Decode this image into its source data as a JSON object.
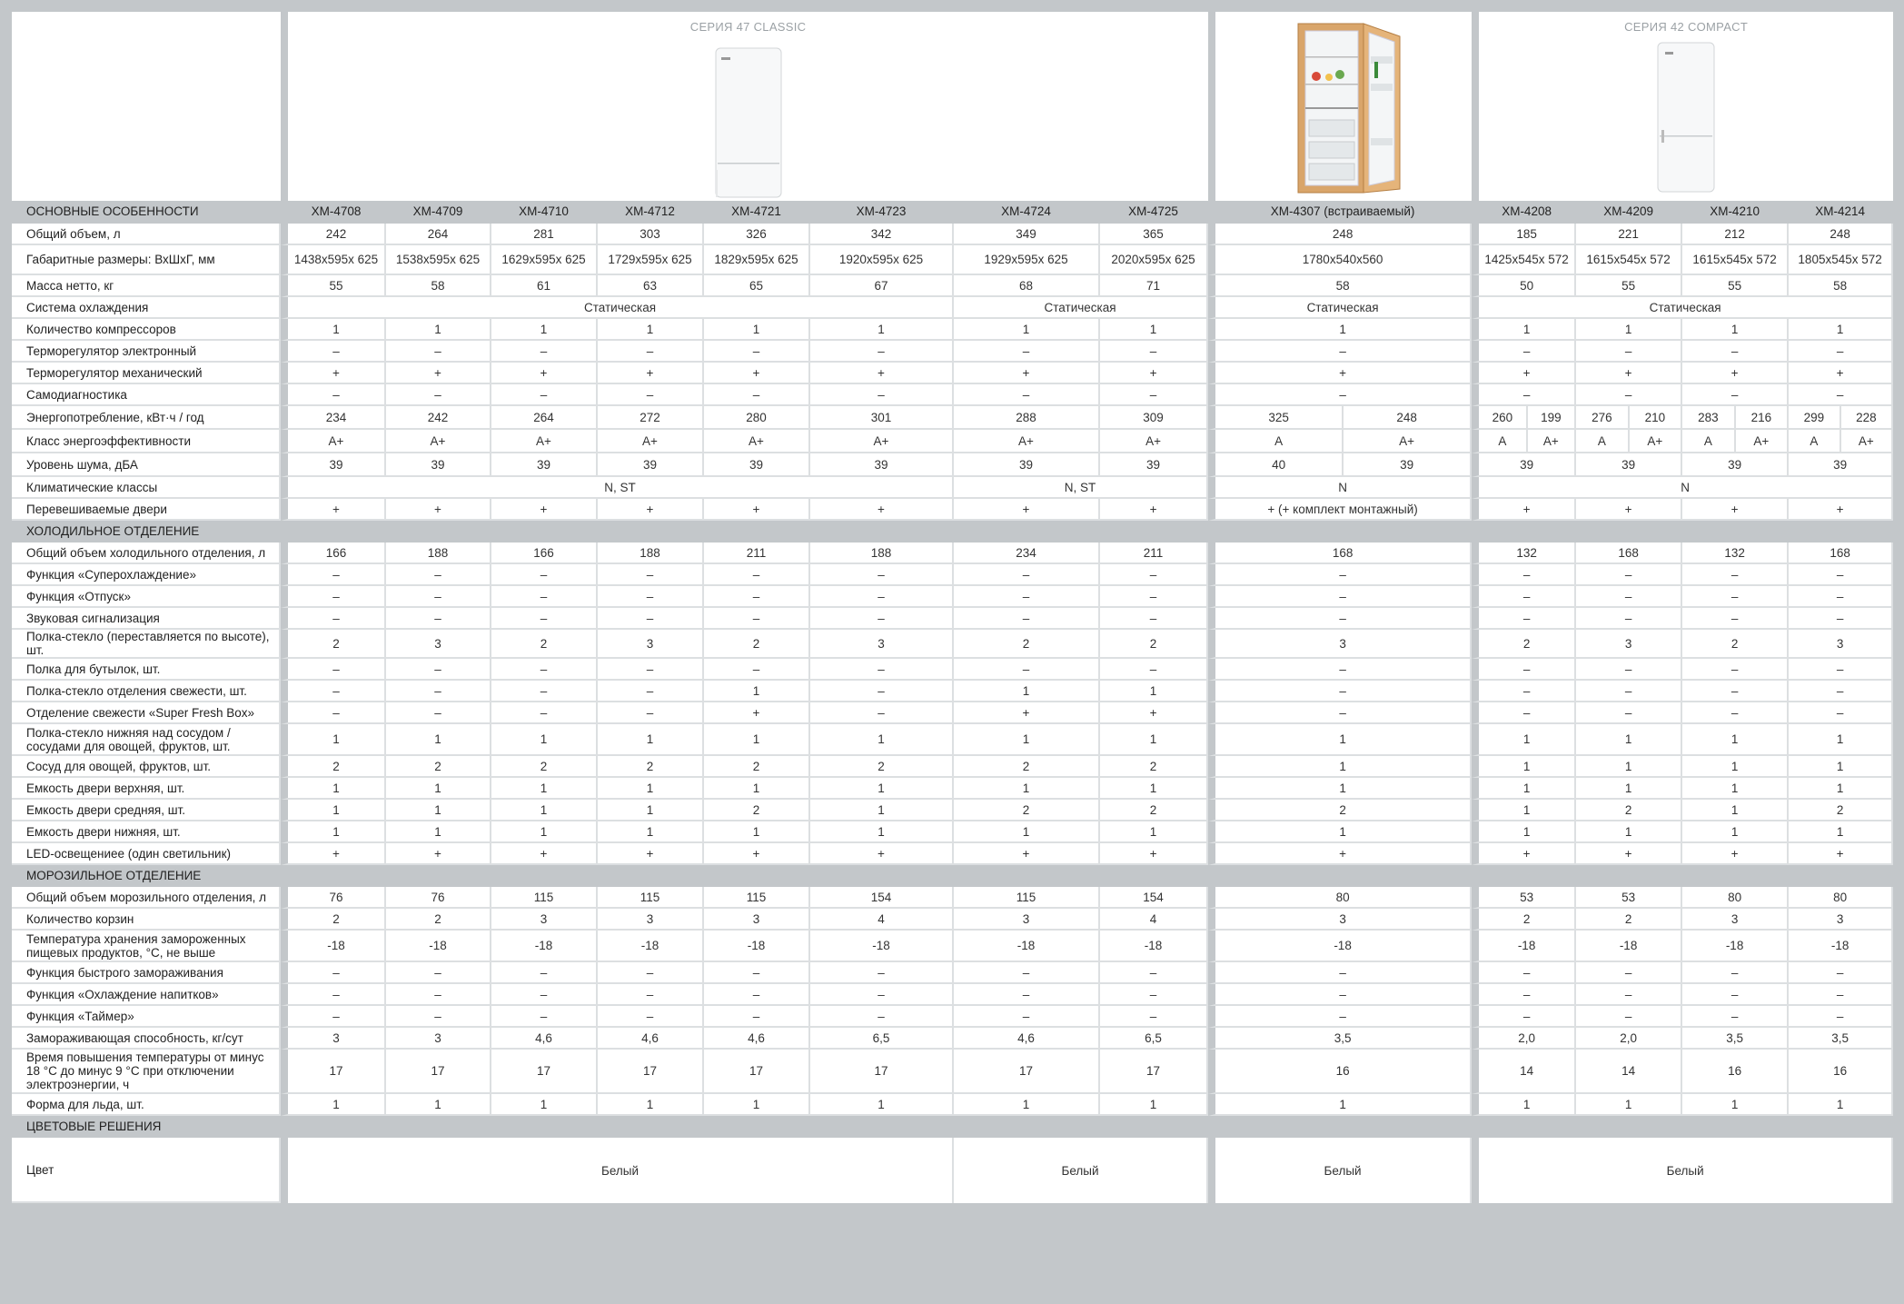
{
  "series": [
    {
      "name": "СЕРИЯ 47 CLASSIC"
    },
    {
      "name": ""
    },
    {
      "name": "СЕРИЯ 42 COMPACT"
    }
  ],
  "models_header": "ОСНОВНЫЕ ОСОБЕННОСТИ",
  "models": [
    "ХМ-4708",
    "ХМ-4709",
    "ХМ-4710",
    "ХМ-4712",
    "ХМ-4721",
    "ХМ-4723",
    "ХМ-4724",
    "ХМ-4725",
    "ХМ-4307 (встраиваемый)",
    "ХМ-4208",
    "ХМ-4209",
    "ХМ-4210",
    "ХМ-4214"
  ],
  "rows_main": [
    {
      "label": "Общий объем, л",
      "cells": [
        "242",
        "264",
        "281",
        "303",
        "326",
        "342",
        "349",
        "365",
        "248",
        "185",
        "221",
        "212",
        "248"
      ]
    },
    {
      "label": "Габаритные размеры: ВхШхГ, мм",
      "cells": [
        "1438x595x 625",
        "1538x595x 625",
        "1629x595x 625",
        "1729x595x 625",
        "1829x595x 625",
        "1920x595x 625",
        "1929x595x 625",
        "2020x595x 625",
        "1780x540x560",
        "1425x545x 572",
        "1615x545x 572",
        "1615x545x 572",
        "1805x545x 572"
      ]
    },
    {
      "label": "Масса нетто, кг",
      "cells": [
        "55",
        "58",
        "61",
        "63",
        "65",
        "67",
        "68",
        "71",
        "58",
        "50",
        "55",
        "55",
        "58"
      ]
    },
    {
      "label": "Система охлаждения",
      "merged": [
        "Статическая",
        "Статическая",
        "Статическая",
        "Статическая"
      ]
    },
    {
      "label": "Количество компрессоров",
      "cells": [
        "1",
        "1",
        "1",
        "1",
        "1",
        "1",
        "1",
        "1",
        "1",
        "1",
        "1",
        "1",
        "1"
      ]
    },
    {
      "label": "Терморегулятор электронный",
      "cells": [
        "–",
        "–",
        "–",
        "–",
        "–",
        "–",
        "–",
        "–",
        "–",
        "–",
        "–",
        "–",
        "–"
      ]
    },
    {
      "label": "Терморегулятор механический",
      "cells": [
        "+",
        "+",
        "+",
        "+",
        "+",
        "+",
        "+",
        "+",
        "+",
        "+",
        "+",
        "+",
        "+"
      ]
    },
    {
      "label": "Самодиагностика",
      "cells": [
        "–",
        "–",
        "–",
        "–",
        "–",
        "–",
        "–",
        "–",
        "–",
        "–",
        "–",
        "–",
        "–"
      ]
    }
  ],
  "energy": {
    "label": "Энергопотребление, кВт·ч / год",
    "classic": [
      "234",
      "242",
      "264",
      "272",
      "280",
      "301",
      "288",
      "309"
    ],
    "builtin": [
      "325",
      "248"
    ],
    "compact": [
      "260",
      "199",
      "276",
      "210",
      "283",
      "216",
      "299",
      "228"
    ]
  },
  "eclass": {
    "label": "Класс энергоэффективности",
    "classic": [
      "A+",
      "A+",
      "A+",
      "A+",
      "A+",
      "A+",
      "A+",
      "A+"
    ],
    "builtin": [
      "A",
      "A+"
    ],
    "compact": [
      "A",
      "A+",
      "A",
      "A+",
      "A",
      "A+",
      "A",
      "A+"
    ]
  },
  "noise": {
    "label": "Уровень шума, дБА",
    "classic": [
      "39",
      "39",
      "39",
      "39",
      "39",
      "39",
      "39",
      "39"
    ],
    "builtin": [
      "40",
      "39"
    ],
    "compact": [
      "39",
      "39",
      "39",
      "39"
    ]
  },
  "climate": {
    "label": "Климатические классы",
    "merged": [
      "N, ST",
      "N, ST",
      "N",
      "N"
    ]
  },
  "doors": {
    "label": "Перевешиваемые двери",
    "cells": [
      "+",
      "+",
      "+",
      "+",
      "+",
      "+",
      "+",
      "+",
      "+ (+ комплект монтажный)",
      "+",
      "+",
      "+",
      "+"
    ]
  },
  "sec_fridge": "ХОЛОДИЛЬНОЕ ОТДЕЛЕНИЕ",
  "rows_fridge": [
    {
      "label": "Общий объем холодильного отделения, л",
      "cells": [
        "166",
        "188",
        "166",
        "188",
        "211",
        "188",
        "234",
        "211",
        "168",
        "132",
        "168",
        "132",
        "168"
      ]
    },
    {
      "label": "Функция «Суперохлаждение»",
      "cells": [
        "–",
        "–",
        "–",
        "–",
        "–",
        "–",
        "–",
        "–",
        "–",
        "–",
        "–",
        "–",
        "–"
      ]
    },
    {
      "label": "Функция «Отпуск»",
      "cells": [
        "–",
        "–",
        "–",
        "–",
        "–",
        "–",
        "–",
        "–",
        "–",
        "–",
        "–",
        "–",
        "–"
      ]
    },
    {
      "label": "Звуковая сигнализация",
      "cells": [
        "–",
        "–",
        "–",
        "–",
        "–",
        "–",
        "–",
        "–",
        "–",
        "–",
        "–",
        "–",
        "–"
      ]
    },
    {
      "label": "Полка-стекло (переставляется по высоте), шт.",
      "cells": [
        "2",
        "3",
        "2",
        "3",
        "2",
        "3",
        "2",
        "2",
        "3",
        "2",
        "3",
        "2",
        "3"
      ]
    },
    {
      "label": "Полка для бутылок, шт.",
      "cells": [
        "–",
        "–",
        "–",
        "–",
        "–",
        "–",
        "–",
        "–",
        "–",
        "–",
        "–",
        "–",
        "–"
      ]
    },
    {
      "label": "Полка-стекло отделения свежести, шт.",
      "cells": [
        "–",
        "–",
        "–",
        "–",
        "1",
        "–",
        "1",
        "1",
        "–",
        "–",
        "–",
        "–",
        "–"
      ]
    },
    {
      "label": "Отделение свежести «Super Fresh Box»",
      "cells": [
        "–",
        "–",
        "–",
        "–",
        "+",
        "–",
        "+",
        "+",
        "–",
        "–",
        "–",
        "–",
        "–"
      ]
    },
    {
      "label": "Полка-стекло нижняя над сосудом / сосудами для овощей, фруктов, шт.",
      "cells": [
        "1",
        "1",
        "1",
        "1",
        "1",
        "1",
        "1",
        "1",
        "1",
        "1",
        "1",
        "1",
        "1"
      ],
      "tall": true
    },
    {
      "label": "Сосуд для овощей, фруктов, шт.",
      "cells": [
        "2",
        "2",
        "2",
        "2",
        "2",
        "2",
        "2",
        "2",
        "1",
        "1",
        "1",
        "1",
        "1"
      ]
    },
    {
      "label": "Емкость двери верхняя, шт.",
      "cells": [
        "1",
        "1",
        "1",
        "1",
        "1",
        "1",
        "1",
        "1",
        "1",
        "1",
        "1",
        "1",
        "1"
      ]
    },
    {
      "label": "Емкость двери средняя, шт.",
      "cells": [
        "1",
        "1",
        "1",
        "1",
        "2",
        "1",
        "2",
        "2",
        "2",
        "1",
        "2",
        "1",
        "2"
      ]
    },
    {
      "label": "Емкость двери нижняя, шт.",
      "cells": [
        "1",
        "1",
        "1",
        "1",
        "1",
        "1",
        "1",
        "1",
        "1",
        "1",
        "1",
        "1",
        "1"
      ]
    },
    {
      "label": "LED-освещениее (один светильник)",
      "cells": [
        "+",
        "+",
        "+",
        "+",
        "+",
        "+",
        "+",
        "+",
        "+",
        "+",
        "+",
        "+",
        "+"
      ]
    }
  ],
  "sec_freezer": "МОРОЗИЛЬНОЕ ОТДЕЛЕНИЕ",
  "rows_freezer": [
    {
      "label": "Общий объем морозильного отделения, л",
      "cells": [
        "76",
        "76",
        "115",
        "115",
        "115",
        "154",
        "115",
        "154",
        "80",
        "53",
        "53",
        "80",
        "80"
      ]
    },
    {
      "label": "Количество корзин",
      "cells": [
        "2",
        "2",
        "3",
        "3",
        "3",
        "4",
        "3",
        "4",
        "3",
        "2",
        "2",
        "3",
        "3"
      ]
    },
    {
      "label": "Температура хранения замороженных пищевых продуктов, °С, не выше",
      "cells": [
        "-18",
        "-18",
        "-18",
        "-18",
        "-18",
        "-18",
        "-18",
        "-18",
        "-18",
        "-18",
        "-18",
        "-18",
        "-18"
      ],
      "tall": true
    },
    {
      "label": "Функция быстрого замораживания",
      "cells": [
        "–",
        "–",
        "–",
        "–",
        "–",
        "–",
        "–",
        "–",
        "–",
        "–",
        "–",
        "–",
        "–"
      ]
    },
    {
      "label": "Функция «Охлаждение напитков»",
      "cells": [
        "–",
        "–",
        "–",
        "–",
        "–",
        "–",
        "–",
        "–",
        "–",
        "–",
        "–",
        "–",
        "–"
      ]
    },
    {
      "label": "Функция «Таймер»",
      "cells": [
        "–",
        "–",
        "–",
        "–",
        "–",
        "–",
        "–",
        "–",
        "–",
        "–",
        "–",
        "–",
        "–"
      ]
    },
    {
      "label": "Замораживающая способность, кг/сут",
      "cells": [
        "3",
        "3",
        "4,6",
        "4,6",
        "4,6",
        "6,5",
        "4,6",
        "6,5",
        "3,5",
        "2,0",
        "2,0",
        "3,5",
        "3,5"
      ]
    },
    {
      "label": "Время повышения температуры от минус 18 °С до минус 9 °С при отключении электроэнергии, ч",
      "cells": [
        "17",
        "17",
        "17",
        "17",
        "17",
        "17",
        "17",
        "17",
        "16",
        "14",
        "14",
        "16",
        "16"
      ],
      "tall3": true
    },
    {
      "label": "Форма для льда, шт.",
      "cells": [
        "1",
        "1",
        "1",
        "1",
        "1",
        "1",
        "1",
        "1",
        "1",
        "1",
        "1",
        "1",
        "1"
      ]
    }
  ],
  "sec_color": "ЦВЕТОВЫЕ РЕШЕНИЯ",
  "color": {
    "label": "Цвет",
    "merged": [
      "Белый",
      "Белый",
      "Белый",
      "Белый"
    ]
  }
}
